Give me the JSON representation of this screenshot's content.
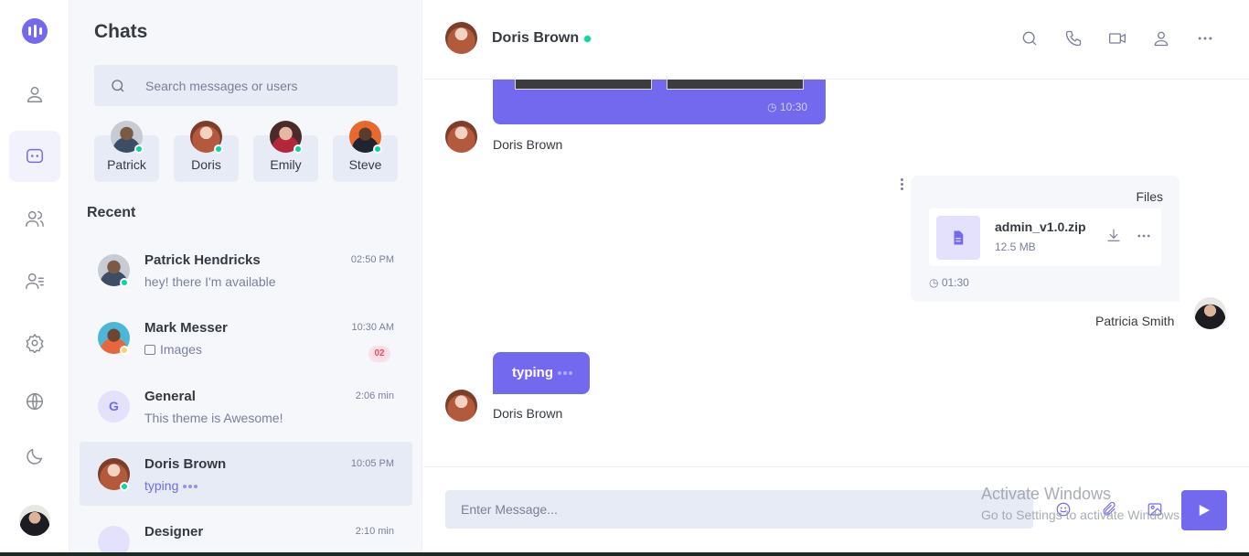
{
  "colors": {
    "accent": "#7269ef",
    "online": "#06d6a0",
    "away": "#ffd166",
    "badge_text": "#ef476f"
  },
  "rail": {
    "items": [
      {
        "icon": "profile-icon"
      },
      {
        "icon": "chat-icon",
        "active": true
      },
      {
        "icon": "groups-icon"
      },
      {
        "icon": "contacts-icon"
      },
      {
        "icon": "settings-icon"
      },
      {
        "icon": "language-icon"
      },
      {
        "icon": "dark-mode-icon"
      }
    ]
  },
  "sidebar": {
    "title": "Chats",
    "search_placeholder": "Search messages or users",
    "online_users": [
      {
        "name": "Patrick"
      },
      {
        "name": "Doris"
      },
      {
        "name": "Emily"
      },
      {
        "name": "Steve"
      }
    ],
    "recent_title": "Recent",
    "chats": [
      {
        "name": "Patrick Hendricks",
        "message": "hey! there I'm available",
        "time": "02:50 PM",
        "status": "online"
      },
      {
        "name": "Mark Messer",
        "message": "Images",
        "time": "10:30 AM",
        "badge": "02",
        "status": "away"
      },
      {
        "name": "General",
        "initial": "G",
        "message": "This theme is Awesome!",
        "time": "2:06 min"
      },
      {
        "name": "Doris Brown",
        "message": "typing",
        "time": "10:05 PM",
        "status": "online",
        "selected": true
      },
      {
        "name": "Designer",
        "time": "2:10 min"
      }
    ]
  },
  "conversation": {
    "contact_name": "Doris Brown",
    "contact_status": "online",
    "header_icons": [
      "search-icon",
      "phone-icon",
      "video-icon",
      "user-icon",
      "more-icon"
    ],
    "image_message_time": "10:30",
    "messages": [
      {
        "sender": "Doris Brown"
      },
      {
        "sender": "Patricia Smith",
        "title": "Files",
        "file_name": "admin_v1.0.zip",
        "file_size": "12.5 MB",
        "time": "01:30"
      },
      {
        "sender": "Doris Brown",
        "text": "typing"
      }
    ],
    "input_placeholder": "Enter Message...",
    "watermark_title": "Activate Windows",
    "watermark_sub": "Go to Settings to activate Windows."
  }
}
